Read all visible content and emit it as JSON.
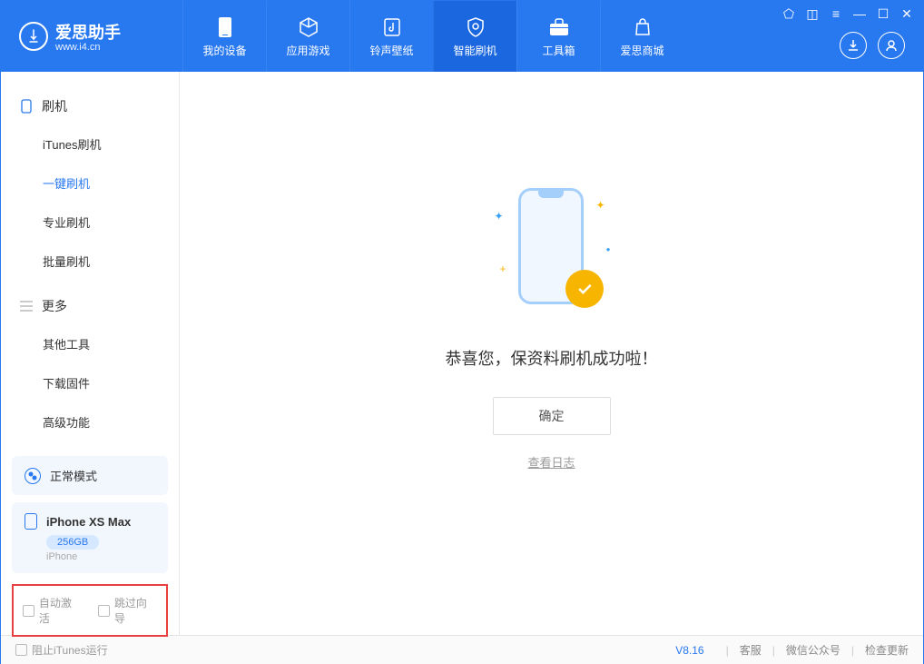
{
  "app": {
    "name": "爱思助手",
    "url": "www.i4.cn"
  },
  "nav": [
    {
      "label": "我的设备"
    },
    {
      "label": "应用游戏"
    },
    {
      "label": "铃声壁纸"
    },
    {
      "label": "智能刷机"
    },
    {
      "label": "工具箱"
    },
    {
      "label": "爱思商城"
    }
  ],
  "sidebar": {
    "group1": {
      "title": "刷机",
      "items": [
        "iTunes刷机",
        "一键刷机",
        "专业刷机",
        "批量刷机"
      ]
    },
    "group2": {
      "title": "更多",
      "items": [
        "其他工具",
        "下载固件",
        "高级功能"
      ]
    }
  },
  "mode": {
    "label": "正常模式"
  },
  "device": {
    "name": "iPhone XS Max",
    "storage": "256GB",
    "type": "iPhone"
  },
  "options": {
    "auto_activate": "自动激活",
    "skip_guide": "跳过向导"
  },
  "main": {
    "success_text": "恭喜您，保资料刷机成功啦！",
    "ok_button": "确定",
    "view_log": "查看日志"
  },
  "footer": {
    "block_itunes": "阻止iTunes运行",
    "version": "V8.16",
    "support": "客服",
    "wechat": "微信公众号",
    "check_update": "检查更新"
  }
}
